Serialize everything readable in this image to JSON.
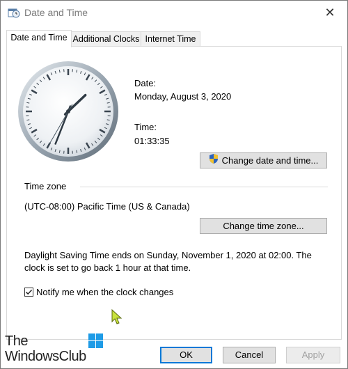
{
  "window": {
    "title": "Date and Time",
    "close_glyph": "✕"
  },
  "tabs": [
    {
      "label": "Date and Time",
      "active": true
    },
    {
      "label": "Additional Clocks",
      "active": false
    },
    {
      "label": "Internet Time",
      "active": false
    }
  ],
  "date_section": {
    "label": "Date:",
    "value": "Monday, August 3, 2020"
  },
  "time_section": {
    "label": "Time:",
    "value": "01:33:35"
  },
  "clock": {
    "hour": 1,
    "minute": 33,
    "second": 35
  },
  "buttons": {
    "change_date_time": "Change date and time...",
    "change_time_zone": "Change time zone...",
    "ok": "OK",
    "cancel": "Cancel",
    "apply": "Apply"
  },
  "timezone": {
    "heading": "Time zone",
    "value": "(UTC-08:00) Pacific Time (US & Canada)"
  },
  "dst": {
    "line1": "Daylight Saving Time ends on Sunday, November 1, 2020 at 02:00. The",
    "line2": "clock is set to go back 1 hour at that time."
  },
  "notify": {
    "label": "Notify me when the clock changes",
    "checked": true
  },
  "watermark": {
    "line1": "The",
    "line2": "WindowsClub"
  },
  "colors": {
    "accent": "#0078d7",
    "button_bg": "#e1e1e1",
    "cursor": "#c8e23c"
  }
}
